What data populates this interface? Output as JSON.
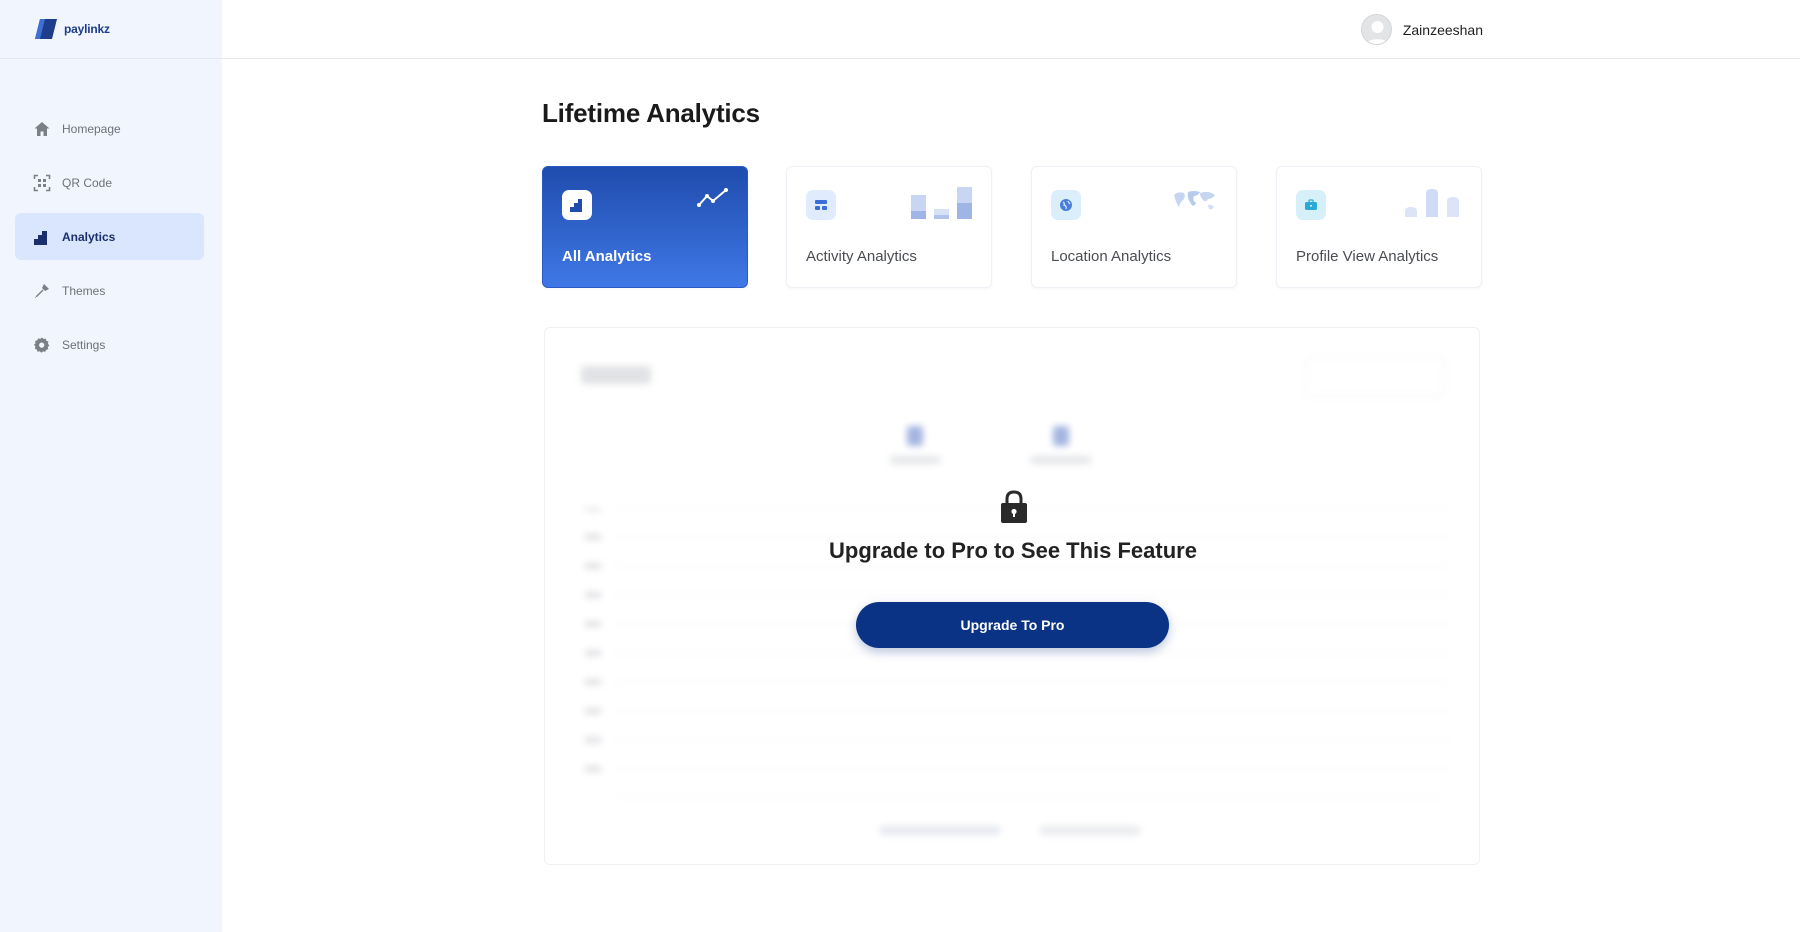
{
  "brand": {
    "name": "paylinkz",
    "color": "#1e3d8a"
  },
  "sidebar": {
    "items": [
      {
        "label": "Homepage",
        "icon": "home-icon",
        "active": false
      },
      {
        "label": "QR Code",
        "icon": "qr-code-icon",
        "active": false
      },
      {
        "label": "Analytics",
        "icon": "analytics-icon",
        "active": true
      },
      {
        "label": "Themes",
        "icon": "paint-brush-icon",
        "active": false
      },
      {
        "label": "Settings",
        "icon": "gear-icon",
        "active": false
      }
    ]
  },
  "header": {
    "username": "Zainzeeshan",
    "avatar_icon": "user-avatar-icon"
  },
  "main": {
    "title": "Lifetime Analytics",
    "cards": [
      {
        "label": "All Analytics",
        "icon": "chart-steps-icon",
        "art": "trend-line-icon",
        "active": true
      },
      {
        "label": "Activity Analytics",
        "icon": "dashboard-icon",
        "art": "bar-chart-icon",
        "active": false
      },
      {
        "label": "Location Analytics",
        "icon": "globe-icon",
        "art": "world-map-icon",
        "active": false
      },
      {
        "label": "Profile View Analytics",
        "icon": "briefcase-icon",
        "art": "column-chart-icon",
        "active": false
      }
    ],
    "locked_panel": {
      "message": "Upgrade to Pro to See This Feature",
      "button_label": "Upgrade To Pro",
      "lock_icon": "lock-icon"
    }
  },
  "colors": {
    "accent": "#0a3386",
    "sidebar_bg": "#f0f5fe",
    "active_nav_bg": "#d9e6fd",
    "card_gradient_top": "#1f4cad",
    "card_gradient_bottom": "#3f78e6"
  }
}
